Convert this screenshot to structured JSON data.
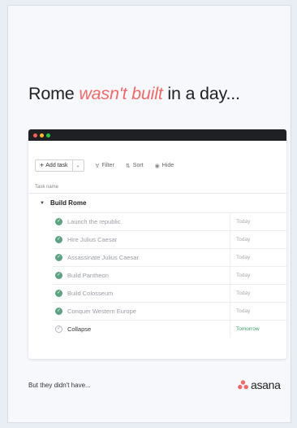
{
  "headline": {
    "before": "Rome ",
    "accent": "wasn't built",
    "after": " in a day..."
  },
  "toolbar": {
    "add_task": "Add task",
    "filter": "Filter",
    "sort": "Sort",
    "hide": "Hide"
  },
  "table": {
    "column_header": "Task name",
    "section": "Build Rome"
  },
  "tasks": [
    {
      "name": "Launch the republic",
      "due": "Today",
      "completed": true
    },
    {
      "name": "Hire Julius Caesar",
      "due": "Today",
      "completed": true
    },
    {
      "name": "Assassinate Julius Caesar",
      "due": "Today",
      "completed": true
    },
    {
      "name": "Build Pantheon",
      "due": "Today",
      "completed": true
    },
    {
      "name": "Build Colosseum",
      "due": "Today",
      "completed": true
    },
    {
      "name": "Conquer Western Europe",
      "due": "Today",
      "completed": true
    },
    {
      "name": "Collapse",
      "due": "Tomorrow",
      "completed": false
    }
  ],
  "footer": {
    "tagline": "But they didn't have...",
    "brand": "asana"
  },
  "colors": {
    "accent": "#f06a6a",
    "check_green": "#5da283",
    "tomorrow_green": "#3f9c6b",
    "titlebar": "#1f2023",
    "traffic_red": "#ff5f57",
    "traffic_yellow": "#febc2e",
    "traffic_green": "#28c840"
  },
  "icons": {
    "add": "plus-icon",
    "dropdown": "chevron-down-icon",
    "filter": "filter-icon",
    "sort": "sort-icon",
    "hide": "hide-icon",
    "section_toggle": "triangle-down-icon",
    "done": "checkmark-circle-icon",
    "open": "empty-check-circle-icon",
    "brand": "asana-logo-icon"
  }
}
